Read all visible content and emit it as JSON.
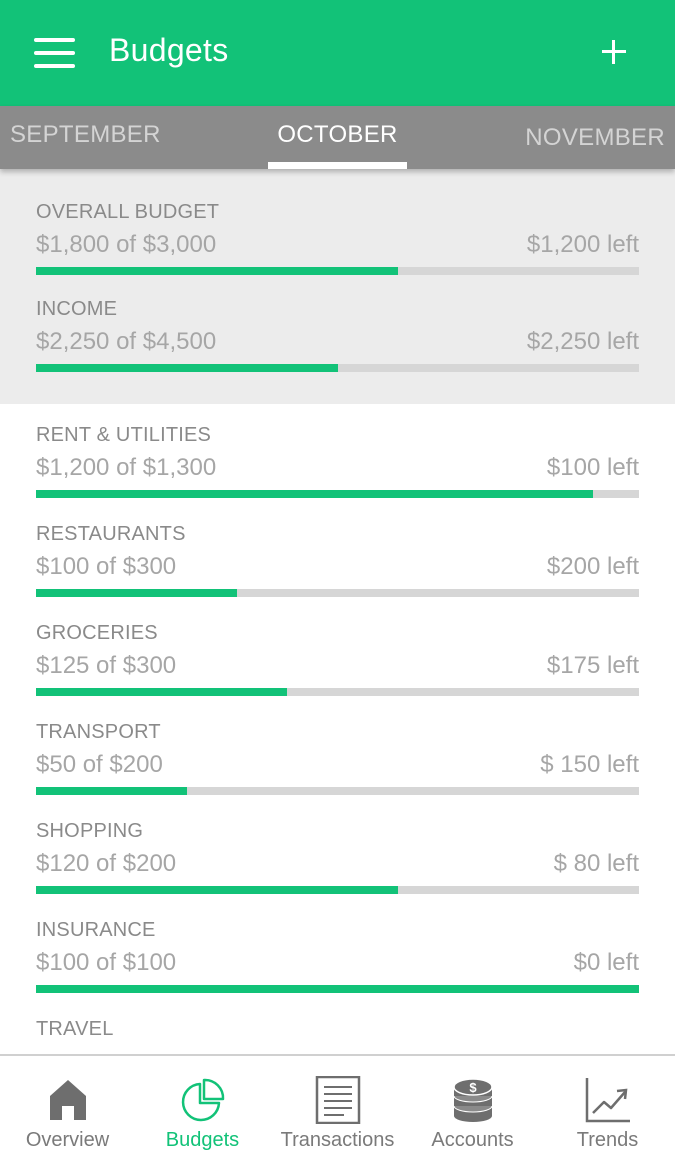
{
  "header": {
    "title": "Budgets",
    "menu_icon": "hamburger-menu-icon",
    "add_icon": "plus-icon"
  },
  "months": {
    "previous": "SEPTEMBER",
    "current": "OCTOBER",
    "next": "NOVEMBER"
  },
  "summary": [
    {
      "title": "OVERALL BUDGET",
      "amount": "$1,800 of $3,000",
      "left": "$1,200 left",
      "progress": 0.6
    },
    {
      "title": "INCOME",
      "amount": "$2,250 of $4,500",
      "left": "$2,250 left",
      "progress": 0.5
    }
  ],
  "categories": [
    {
      "title": "RENT & UTILITIES",
      "amount": "$1,200 of $1,300",
      "left": "$100 left",
      "progress": 0.923
    },
    {
      "title": "RESTAURANTS",
      "amount": "$100 of $300",
      "left": "$200 left",
      "progress": 0.333
    },
    {
      "title": "GROCERIES",
      "amount": "$125 of $300",
      "left": "$175 left",
      "progress": 0.417
    },
    {
      "title": "TRANSPORT",
      "amount": "$50 of $200",
      "left": "$ 150 left",
      "progress": 0.25
    },
    {
      "title": "SHOPPING",
      "amount": "$120 of $200",
      "left": "$ 80 left",
      "progress": 0.6
    },
    {
      "title": "INSURANCE",
      "amount": "$100 of $100",
      "left": "$0 left",
      "progress": 1.0
    },
    {
      "title": "TRAVEL"
    }
  ],
  "tabs": [
    {
      "label": "Overview",
      "icon": "home-icon",
      "active": false
    },
    {
      "label": "Budgets",
      "icon": "pie-chart-icon",
      "active": true
    },
    {
      "label": "Transactions",
      "icon": "document-list-icon",
      "active": false
    },
    {
      "label": "Accounts",
      "icon": "coin-stack-icon",
      "active": false
    },
    {
      "label": "Trends",
      "icon": "line-chart-icon",
      "active": false
    }
  ],
  "colors": {
    "brand": "#12c278",
    "month_bar": "#8b8b8b",
    "summary_bg": "#ececec",
    "track": "#d6d6d6",
    "inactive_tab": "#7a7a7a"
  }
}
